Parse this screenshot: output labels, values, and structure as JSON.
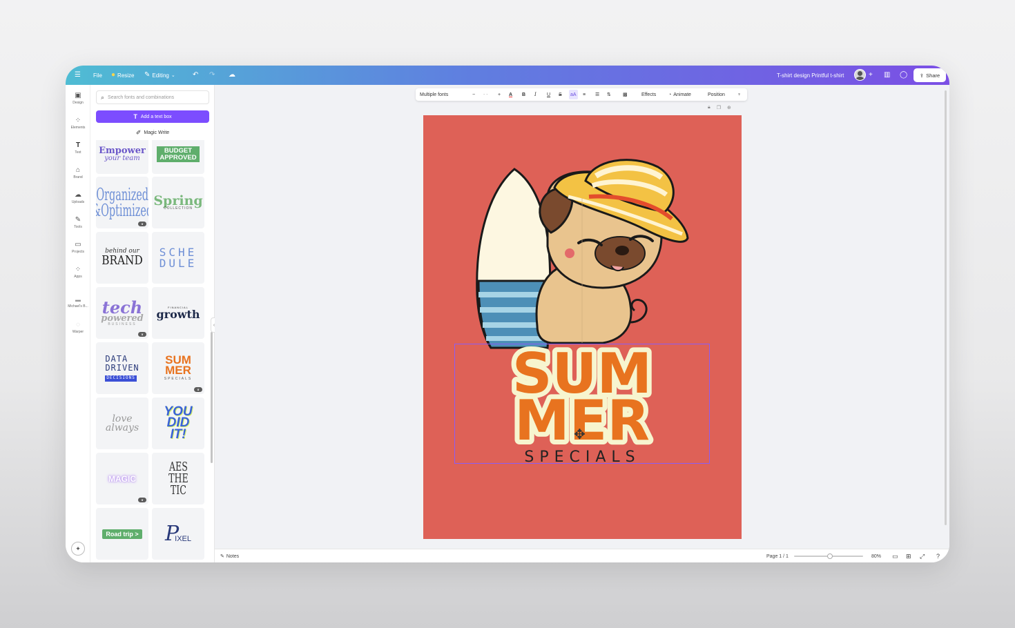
{
  "topbar": {
    "file": "File",
    "resize": "Resize",
    "editing": "Editing",
    "doc_title": "T-shirt design Printful t-shirt",
    "share": "Share"
  },
  "rail": {
    "items": [
      {
        "label": "Design",
        "icon": "design-icon"
      },
      {
        "label": "Elements",
        "icon": "elements-icon"
      },
      {
        "label": "Text",
        "icon": "text-icon"
      },
      {
        "label": "Brand",
        "icon": "brand-icon"
      },
      {
        "label": "Uploads",
        "icon": "uploads-icon"
      },
      {
        "label": "Tools",
        "icon": "tools-icon"
      },
      {
        "label": "Projects",
        "icon": "projects-icon"
      },
      {
        "label": "Apps",
        "icon": "apps-icon"
      },
      {
        "label": "Michael's B...",
        "icon": "folder-icon"
      },
      {
        "label": "Warper",
        "icon": "warper-icon"
      }
    ]
  },
  "panel": {
    "search_placeholder": "Search fonts and combinations",
    "add_text_box": "Add a text box",
    "magic_write": "Magic Write",
    "thumbs": {
      "t1a": "Empower",
      "t1b": "your team",
      "t2a": "BUDGET",
      "t2b": "APPROVED",
      "t3a": "Organized",
      "t3b": "&Optimized",
      "t4a": "Spring",
      "t4b": "COLLECTION",
      "t5a": "behind our",
      "t5b": "BRAND",
      "t6a": "SCHE",
      "t6b": "DULE",
      "t7a": "tech",
      "t7b": "powered",
      "t7c": "BUSINESS",
      "t8a": "FINANCIAL",
      "t8b": "growth",
      "t9a": "DATA",
      "t9b": "DRIVEN",
      "t9c": "DECISIONS",
      "t10a": "SUM",
      "t10b": "MER",
      "t10c": "SPECIALS",
      "t11a": "love",
      "t11b": "always",
      "t12a": "YOU",
      "t12b": "DID",
      "t12c": "IT!",
      "t13a": "MAGIC",
      "t14a": "AES",
      "t14b": "THE",
      "t14c": "TIC",
      "t15a": "Road trip >",
      "t16a": "P",
      "t16b": "IXEL"
    }
  },
  "toolbar": {
    "font": "Multiple fonts",
    "minus": "−",
    "size": "- -",
    "plus": "+",
    "effects": "Effects",
    "animate": "Animate",
    "position": "Position"
  },
  "design": {
    "line1": "SUM",
    "line2": "MER",
    "line3": "SPECIALS",
    "bg_color": "#de6157",
    "accent_orange": "#e8731f",
    "cream": "#f7f5cf"
  },
  "bottombar": {
    "notes": "Notes",
    "page": "Page 1 / 1",
    "zoom": "80%",
    "zoom_value": 0.52
  }
}
